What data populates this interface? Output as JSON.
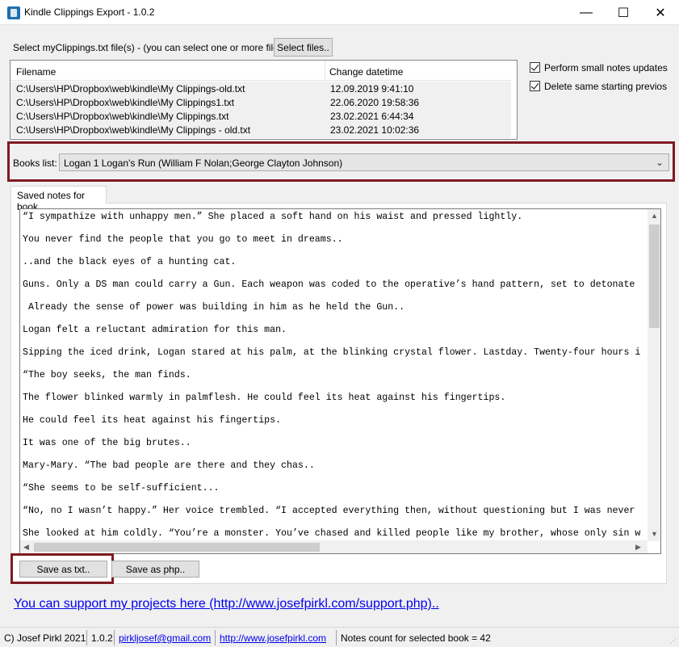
{
  "window": {
    "title": "Kindle Clippings Export - 1.0.2",
    "minimize": "—",
    "maximize": "☐",
    "close": "✕"
  },
  "files": {
    "prompt": "Select myClippings.txt file(s) - (you can select one or more files):",
    "select_button": "Select files..",
    "columns": [
      "Filename",
      "Change datetime"
    ],
    "rows": [
      {
        "filename": "C:\\Users\\HP\\Dropbox\\web\\kindle\\My Clippings-old.txt",
        "datetime": "12.09.2019 9:41:10"
      },
      {
        "filename": "C:\\Users\\HP\\Dropbox\\web\\kindle\\My Clippings1.txt",
        "datetime": "22.06.2020 19:58:36"
      },
      {
        "filename": "C:\\Users\\HP\\Dropbox\\web\\kindle\\My Clippings.txt",
        "datetime": "23.02.2021 6:44:34"
      },
      {
        "filename": "C:\\Users\\HP\\Dropbox\\web\\kindle\\My Clippings - old.txt",
        "datetime": "23.02.2021 10:02:36"
      }
    ]
  },
  "options": {
    "small_notes": {
      "label": "Perform small notes updates",
      "checked": true
    },
    "delete_same": {
      "label": "Delete same starting previos",
      "checked": true
    }
  },
  "books": {
    "label": "Books list:",
    "selected": "Logan 1 Logan's Run (William F Nolan;George Clayton Johnson)"
  },
  "notes": {
    "tab_label": "Saved notes for book",
    "lines": [
      "“I sympathize with unhappy men.” She placed a soft hand on his waist and pressed lightly.",
      "You never find the people that you go to meet in dreams..",
      "..and the black eyes of a hunting cat.",
      "Guns. Only a DS man could carry a Gun. Each weapon was coded to the operative’s hand pattern, set to detonate",
      " Already the sense of power was building in him as he held the Gun..",
      "Logan felt a reluctant admiration for this man.",
      "Sipping the iced drink, Logan stared at his palm, at the blinking crystal flower. Lastday. Twenty-four hours i",
      "“The boy seeks, the man finds.",
      "The flower blinked warmly in palmflesh. He could feel its heat against his fingertips.",
      "He could feel its heat against his fingertips.",
      "It was one of the big brutes..",
      "Mary-Mary. “The bad people are there and they chas..",
      "“She seems to be self-sufficient...",
      "“No, no I wasn’t happy.” Her voice trembled. “I accepted everything then, without questioning but I was never",
      "She looked at him coldly. “You’re a monster. You’ve chased and killed people like my brother, whose only sin w"
    ],
    "save_txt": "Save as txt..",
    "save_php": "Save as php.."
  },
  "support_link": "You can support my projects here (http://www.josefpirkl.com/support.php)..",
  "status_bar": {
    "copyright": "C) Josef Pirkl 2021",
    "version": "1.0.2",
    "email": "pirkljosef@gmail.com",
    "website": "http://www.josefpirkl.com",
    "notes_count": "Notes count for selected book = 42"
  },
  "colors": {
    "highlight_border": "#7f1a22",
    "link": "#0000ee"
  }
}
